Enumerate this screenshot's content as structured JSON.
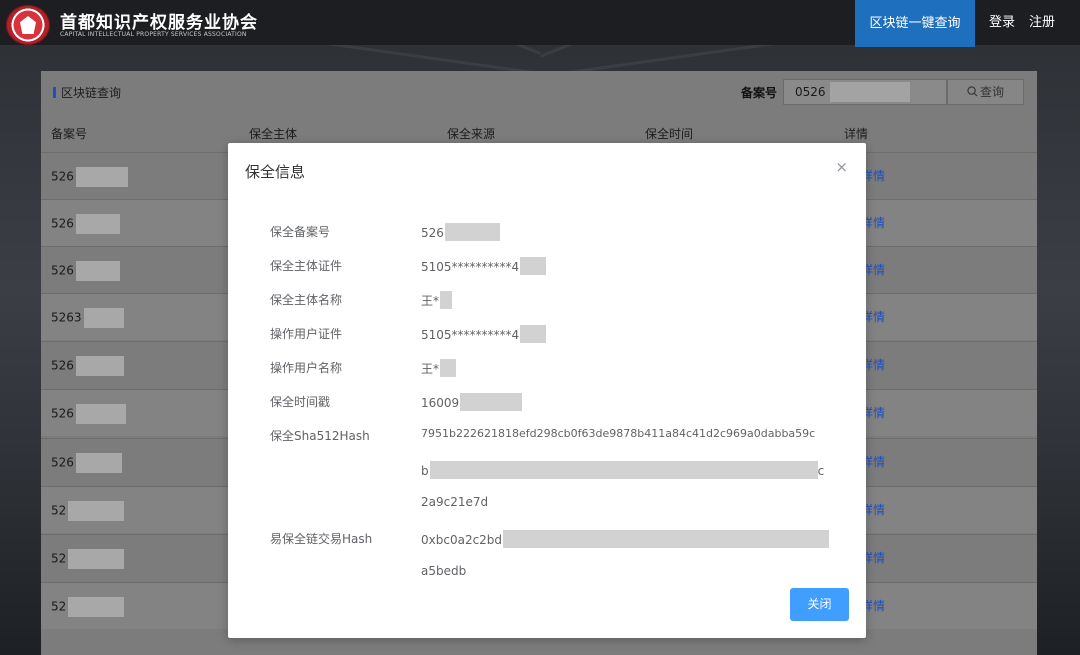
{
  "header": {
    "logo_title": "首都知识产权服务业协会",
    "logo_subtitle": "CAPITAL INTELLECTUAL PROPERTY SERVICES ASSOCIATION",
    "nav_active": "区块链一键查询",
    "login": "登录",
    "register": "注册"
  },
  "panel": {
    "title": "区块链查询",
    "filter_label": "备案号",
    "filter_value": "0526",
    "query_button": "查询",
    "columns": [
      "备案号",
      "保全主体",
      "保全来源",
      "保全时间",
      "详情"
    ],
    "rows": [
      {
        "id": "526",
        "detail": "详情"
      },
      {
        "id": "526",
        "detail": "详情"
      },
      {
        "id": "526",
        "detail": "详情"
      },
      {
        "id": "5263",
        "detail": "详情"
      },
      {
        "id": "526",
        "detail": "详情"
      },
      {
        "id": "526",
        "detail": "详情"
      },
      {
        "id": "526",
        "detail": "详情"
      },
      {
        "id": "52",
        "detail": "详情"
      },
      {
        "id": "52",
        "detail": "详情"
      },
      {
        "id": "52",
        "detail": "详情"
      }
    ]
  },
  "modal": {
    "title": "保全信息",
    "close_icon": "×",
    "fields": [
      {
        "label": "保全备案号",
        "value": "526"
      },
      {
        "label": "保全主体证件",
        "value": "5105**********4"
      },
      {
        "label": "保全主体名称",
        "value": "王*"
      },
      {
        "label": "操作用户证件",
        "value": "5105**********4"
      },
      {
        "label": "操作用户名称",
        "value": "王*"
      },
      {
        "label": "保全时间戳",
        "value": "16009"
      },
      {
        "label": "保全Sha512Hash",
        "value_lines": [
          "7951b222621818efd298cb0f63de9878b411a84c41d2c969a0dabba59c",
          "b",
          "c",
          "2a9c21e7d"
        ]
      },
      {
        "label": "易保全链交易Hash",
        "value_lines": [
          "0xbc0a2c2bd",
          "a5bedb"
        ]
      }
    ],
    "close_button": "关闭"
  },
  "colors": {
    "accent": "#409eff",
    "nav_active_bg": "#1f6fbf",
    "header_bg": "#1d1e22"
  }
}
